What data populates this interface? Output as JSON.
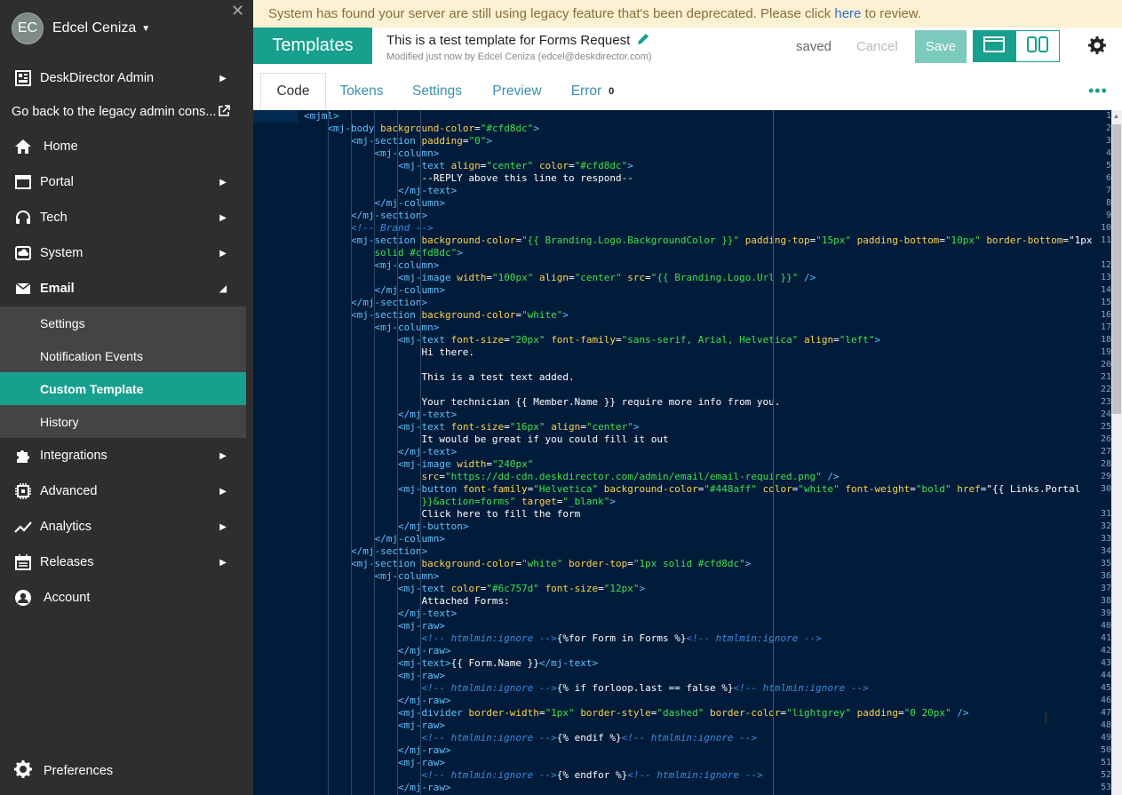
{
  "banner": {
    "prefix": "System has found your server are still using legacy feature that's been deprecated. Please click ",
    "link": "here",
    "suffix": " to review."
  },
  "user": {
    "initials": "EC",
    "name": "Edcel Ceniza"
  },
  "sidebar": {
    "items": [
      {
        "label": "DeskDirector Admin"
      },
      {
        "label": "Go back to the legacy admin cons..."
      },
      {
        "label": "Home"
      },
      {
        "label": "Portal"
      },
      {
        "label": "Tech"
      },
      {
        "label": "System"
      },
      {
        "label": "Email"
      },
      {
        "label": "Integrations"
      },
      {
        "label": "Advanced"
      },
      {
        "label": "Analytics"
      },
      {
        "label": "Releases"
      },
      {
        "label": "Account"
      }
    ],
    "email_sub": [
      {
        "label": "Settings"
      },
      {
        "label": "Notification Events"
      },
      {
        "label": "Custom Template"
      },
      {
        "label": "History"
      }
    ],
    "preferences": "Preferences"
  },
  "header": {
    "section": "Templates",
    "title": "This is a test template for Forms Request",
    "subtitle": "Modified just now by Edcel Ceniza (edcel@deskdirector.com)",
    "status": "saved",
    "cancel": "Cancel",
    "save": "Save"
  },
  "tabs": [
    {
      "label": "Code"
    },
    {
      "label": "Tokens"
    },
    {
      "label": "Settings"
    },
    {
      "label": "Preview"
    },
    {
      "label": "Error",
      "count": "0"
    }
  ],
  "code_lines": [
    "<mjml>",
    "    <mj-body background-color=\"#cfd8dc\">",
    "        <mj-section padding=\"0\">",
    "            <mj-column>",
    "                <mj-text align=\"center\" color=\"#cfd8dc\">",
    "                    --REPLY above this line to respond--",
    "                </mj-text>",
    "            </mj-column>",
    "        </mj-section>",
    "        <!-- Brand -->",
    "        <mj-section background-color=\"{{ Branding.Logo.BackgroundColor }}\" padding-top=\"15px\" padding-bottom=\"10px\" border-bottom=\"1px",
    "            solid #cfd8dc\">",
    "            <mj-column>",
    "                <mj-image width=\"100px\" align=\"center\" src=\"{{ Branding.Logo.Url }}\" />",
    "            </mj-column>",
    "        </mj-section>",
    "        <mj-section background-color=\"white\">",
    "            <mj-column>",
    "                <mj-text font-size=\"20px\" font-family=\"sans-serif, Arial, Helvetica\" align=\"left\">",
    "                    Hi there.",
    "",
    "                    This is a test text added.",
    "",
    "                    Your technician {{ Member.Name }} require more info from you.",
    "                </mj-text>",
    "                <mj-text font-size=\"16px\" align=\"center\">",
    "                    It would be great if you could fill it out",
    "                </mj-text>",
    "                <mj-image width=\"240px\"",
    "                    src=\"https://dd-cdn.deskdirector.com/admin/email/email-required.png\" />",
    "                <mj-button font-family=\"Helvetica\" background-color=\"#448aff\" color=\"white\" font-weight=\"bold\" href=\"{{ Links.Portal",
    "                    }}&action=forms\" target=\"_blank\">",
    "                    Click here to fill the form",
    "                </mj-button>",
    "            </mj-column>",
    "        </mj-section>",
    "        <mj-section background-color=\"white\" border-top=\"1px solid #cfd8dc\">",
    "            <mj-column>",
    "                <mj-text color=\"#6c757d\" font-size=\"12px\">",
    "                    Attached Forms:",
    "                </mj-text>",
    "                <mj-raw>",
    "                    <!-- htmlmin:ignore -->{%for Form in Forms %}<!-- htmlmin:ignore -->",
    "                </mj-raw>",
    "                <mj-text>{{ Form.Name }}</mj-text>",
    "                <mj-raw>",
    "                    <!-- htmlmin:ignore -->{% if forloop.last == false %}<!-- htmlmin:ignore -->",
    "                </mj-raw>",
    "                <mj-divider border-width=\"1px\" border-style=\"dashed\" border-color=\"lightgrey\" padding=\"0 20px\" />",
    "                <mj-raw>",
    "                    <!-- htmlmin:ignore -->{% endif %}<!-- htmlmin:ignore -->",
    "                </mj-raw>",
    "                <mj-raw>",
    "                    <!-- htmlmin:ignore -->{% endfor %}<!-- htmlmin:ignore -->",
    "                </mj-raw>"
  ],
  "line_numbers": [
    "1",
    "2",
    "3",
    "4",
    "5",
    "6",
    "7",
    "8",
    "9",
    "10",
    "11",
    "",
    "12",
    "13",
    "14",
    "15",
    "16",
    "17",
    "18",
    "19",
    "20",
    "21",
    "22",
    "23",
    "24",
    "25",
    "26",
    "27",
    "28",
    "29",
    "30",
    "",
    "31",
    "32",
    "33",
    "34",
    "35",
    "36",
    "37",
    "38",
    "39",
    "40",
    "41",
    "42",
    "43",
    "44",
    "45",
    "46",
    "47",
    "48",
    "49",
    "50",
    "51",
    "52",
    "53"
  ],
  "colors": {
    "accent": "#17a08d",
    "editor_bg": "#011c3a",
    "tag": "#60c0ff",
    "attr": "#ffd24d",
    "string": "#40e24a",
    "comment": "#3d8ae0"
  }
}
